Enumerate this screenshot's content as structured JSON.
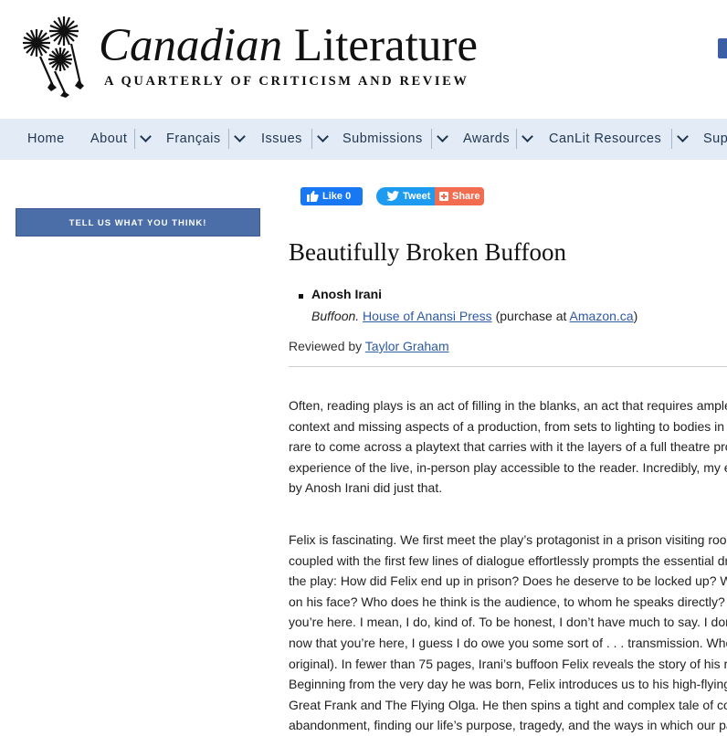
{
  "header": {
    "title_italic": "Canadian",
    "title_regular": "Literature",
    "subtitle": "A QUARTERLY OF CRITICISM AND REVIEW"
  },
  "nav": {
    "items": [
      {
        "label": "Home"
      },
      {
        "label": "About"
      },
      {
        "label": "Français"
      },
      {
        "label": "Issues"
      },
      {
        "label": "Submissions"
      },
      {
        "label": "Awards"
      },
      {
        "label": "CanLit Resources"
      },
      {
        "label": "Sup"
      }
    ]
  },
  "sidebar": {
    "feedback_label": "TELL US WHAT YOU THINK!"
  },
  "social": {
    "like_label": "Like 0",
    "tweet_label": "Tweet",
    "share_label": "Share"
  },
  "article": {
    "title": "Beautifully Broken Buffoon",
    "author": "Anosh Irani",
    "book_title": "Buffoon.",
    "publisher": "House of Anansi Press",
    "purchase_prefix": "(purchase at",
    "purchase_link": "Amazon.ca",
    "purchase_suffix": ")",
    "reviewed_prefix": "Reviewed by",
    "reviewer": "Taylor Graham",
    "paragraph1": [
      "Often, reading plays is an act of filling in the blanks, an act that requires ample",
      "context and missing aspects of a production, from sets to lighting to bodies in",
      "rare to come across a playtext that carries with it the layers of a full theatre pro",
      "experience of the live, in-person play accessible to the reader. Incredibly, my e",
      "by Anosh Irani did just that."
    ],
    "paragraph2": [
      "Felix is fascinating. We first meet the play’s protagonist in a prison visiting roo",
      "coupled with the first few lines of dialogue effortlessly prompts the essential dr",
      "the play: How did Felix end up in prison? Does he deserve to be locked up? W",
      "on his face? Who does he think is the audience, to whom he speaks directly?",
      "you’re here. I mean, I do, kind of. To be honest, I don’t have much to say. I dor",
      "now that you’re here, I guess I do owe you some sort of . . . transmission. Whe",
      "original). In fewer than 75 pages, Irani’s buffoon Felix reveals the story of his r",
      "Beginning from the very day he was born, Felix introduces us to his high-flying",
      "Great Frank and The Flying Olga. He then spins a tight and complex tale of co",
      "abandonment, finding our life’s purpose, tragedy, and the ways in which our pa"
    ]
  }
}
